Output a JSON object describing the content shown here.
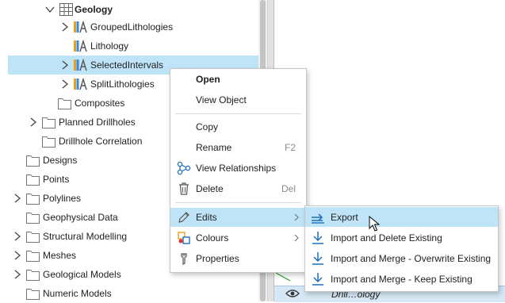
{
  "tree": {
    "items": [
      {
        "label": "Geology"
      },
      {
        "label": "GroupedLithologies"
      },
      {
        "label": "Lithology"
      },
      {
        "label": "SelectedIntervals"
      },
      {
        "label": "SplitLithologies"
      },
      {
        "label": "Composites"
      },
      {
        "label": "Planned Drillholes"
      },
      {
        "label": "Drillhole Correlation"
      },
      {
        "label": "Designs"
      },
      {
        "label": "Points"
      },
      {
        "label": "Polylines"
      },
      {
        "label": "Geophysical Data"
      },
      {
        "label": "Structural Modelling"
      },
      {
        "label": "Meshes"
      },
      {
        "label": "Geological Models"
      },
      {
        "label": "Numeric Models"
      }
    ]
  },
  "context_menu": {
    "items": [
      {
        "label": "Open"
      },
      {
        "label": "View Object"
      },
      {
        "label": "Copy"
      },
      {
        "label": "Rename",
        "shortcut": "F2"
      },
      {
        "label": "View Relationships"
      },
      {
        "label": "Delete",
        "shortcut": "Del"
      },
      {
        "label": "Edits"
      },
      {
        "label": "Colours"
      },
      {
        "label": "Properties"
      }
    ]
  },
  "edits_submenu": {
    "items": [
      {
        "label": "Export"
      },
      {
        "label": "Import and Delete Existing"
      },
      {
        "label": "Import and Merge - Overwrite Existing"
      },
      {
        "label": "Import and Merge - Keep Existing"
      }
    ]
  },
  "viewer_bar": {
    "label": "Drill…ology"
  },
  "colors": {
    "selection": "#bfe3f7",
    "icon_blue": "#1e6fb8",
    "icon_orange": "#e8a020"
  }
}
